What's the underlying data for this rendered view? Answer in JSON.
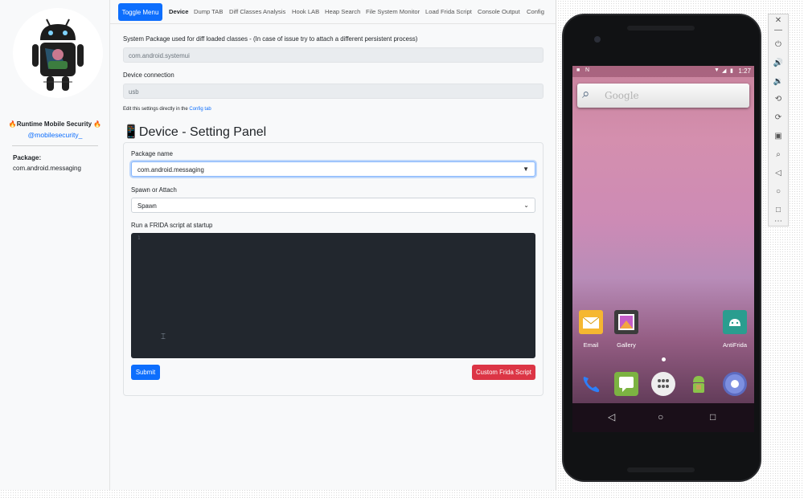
{
  "sidebar": {
    "title": "🔥Runtime Mobile Security 🔥",
    "handle": "@mobilesecurity_",
    "package_label": "Package:",
    "package_value": "com.android.messaging"
  },
  "nav": {
    "toggle_label": "Toggle Menu",
    "tabs": [
      "Device",
      "Dump TAB",
      "Diff Classes Analysis",
      "Hook LAB",
      "Heap Search",
      "File System Monitor",
      "Load Frida Script",
      "Console Output",
      "Config"
    ],
    "active_tab": "Device"
  },
  "main": {
    "system_package_label": "System Package used for diff loaded classes - (In case of issue try to attach a different persistent process)",
    "system_package_value": "com.android.systemui",
    "device_connection_label": "Device connection",
    "device_connection_value": "usb",
    "edit_hint_prefix": "Edit this settings directly in the",
    "edit_hint_link": "Config tab",
    "panel_heading": "📱Device - Setting Panel",
    "package_name_label": "Package name",
    "package_name_value": "com.android.messaging",
    "spawn_attach_label": "Spawn or Attach",
    "spawn_attach_value": "Spawn",
    "frida_script_label": "Run a FRIDA script at startup",
    "editor_line_number": "1",
    "submit_label": "Submit",
    "custom_script_label": "Custom Frida Script"
  },
  "phone": {
    "status_time": "1:27",
    "google_label": "Google",
    "apps": [
      {
        "label": "Email",
        "color": "#f5b731"
      },
      {
        "label": "Gallery",
        "color": "#3b3b3b"
      },
      {
        "label": "AntiFrida",
        "color": "#2a9d8f"
      }
    ],
    "dock_colors": [
      "#2d7ff9",
      "#7cb342",
      "#eeeeee",
      "#8bc34a",
      "#5c6bc0"
    ]
  },
  "colors": {
    "primary": "#0d6efd",
    "danger": "#dc3545",
    "editor_bg": "#22272e"
  }
}
